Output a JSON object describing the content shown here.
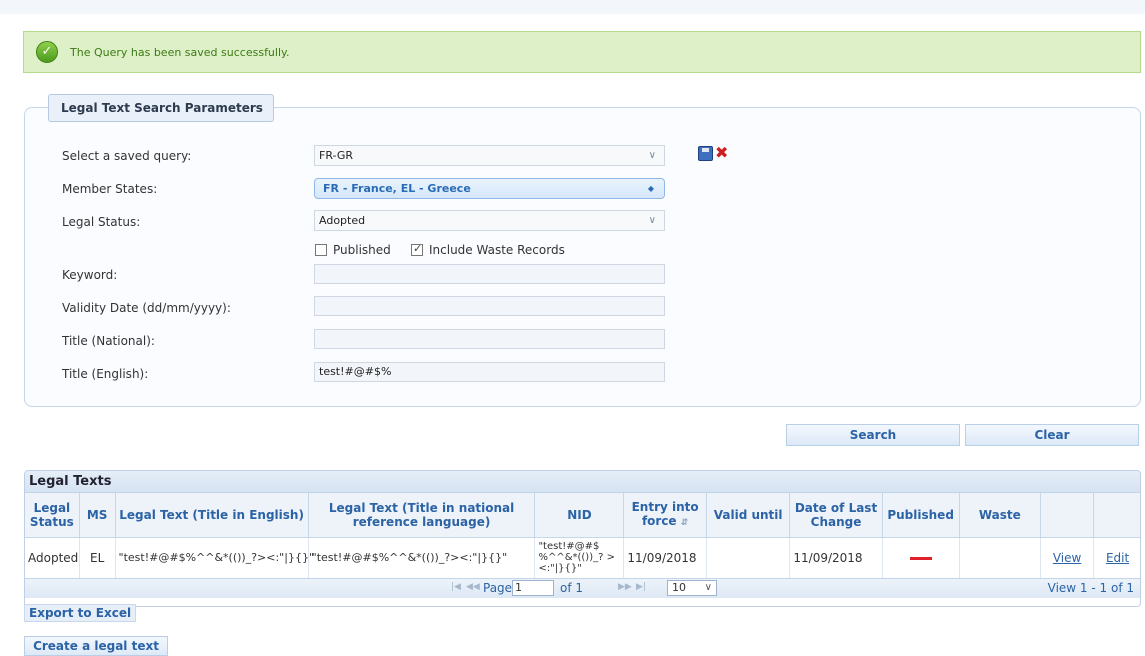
{
  "notification": {
    "message": "The Query has been saved successfully.",
    "icon": "check-circle-icon"
  },
  "search_params": {
    "legend": "Legal Text Search Parameters",
    "saved_query": {
      "label": "Select a saved query:",
      "value": "FR-GR"
    },
    "member_states": {
      "label": "Member States:",
      "value": "FR - France, EL - Greece"
    },
    "legal_status": {
      "label": "Legal Status:",
      "value": "Adopted"
    },
    "published": {
      "label": "Published",
      "checked": false
    },
    "include_waste": {
      "label": "Include Waste Records",
      "checked": true
    },
    "keyword": {
      "label": "Keyword:",
      "value": ""
    },
    "validity_date": {
      "label": "Validity Date (dd/mm/yyyy):",
      "value": ""
    },
    "title_national": {
      "label": "Title (National):",
      "value": ""
    },
    "title_english": {
      "label": "Title (English):",
      "value": "test!#@#$%"
    }
  },
  "actions": {
    "search": "Search",
    "clear": "Clear"
  },
  "legal_texts": {
    "caption": "Legal Texts",
    "headers": [
      "Legal Status",
      "MS",
      "Legal Text (Title in English)",
      "Legal Text (Title in national reference language)",
      "NID",
      "Entry into force",
      "Valid until",
      "Date of Last Change",
      "Published",
      "Waste",
      "",
      ""
    ],
    "rows": [
      {
        "legal_status": "Adopted",
        "ms": "EL",
        "title_en": "\"test!#@#$%^^&*(())_?><:\"|}{}\"",
        "title_nat": "\"test!#@#$%^^&*(())_?><:\"|}{}\"",
        "nid": "\"test!#@#$ %^^&*(())_? ><:\"|}{}\"",
        "entry_into_force": "11/09/2018",
        "valid_until": "",
        "last_change": "11/09/2018",
        "waste": "",
        "view": "View",
        "edit": "Edit"
      }
    ],
    "pager": {
      "page_label": "Page",
      "page": "1",
      "of_label": "of 1",
      "page_size": "10",
      "summary": "View 1 - 1 of 1"
    }
  },
  "export_label": "Export to Excel",
  "create_label": "Create a legal text",
  "colors": {
    "accent": "#2b63a6",
    "success_bg": "#ddf0c7",
    "published_no": "#e0202a"
  }
}
